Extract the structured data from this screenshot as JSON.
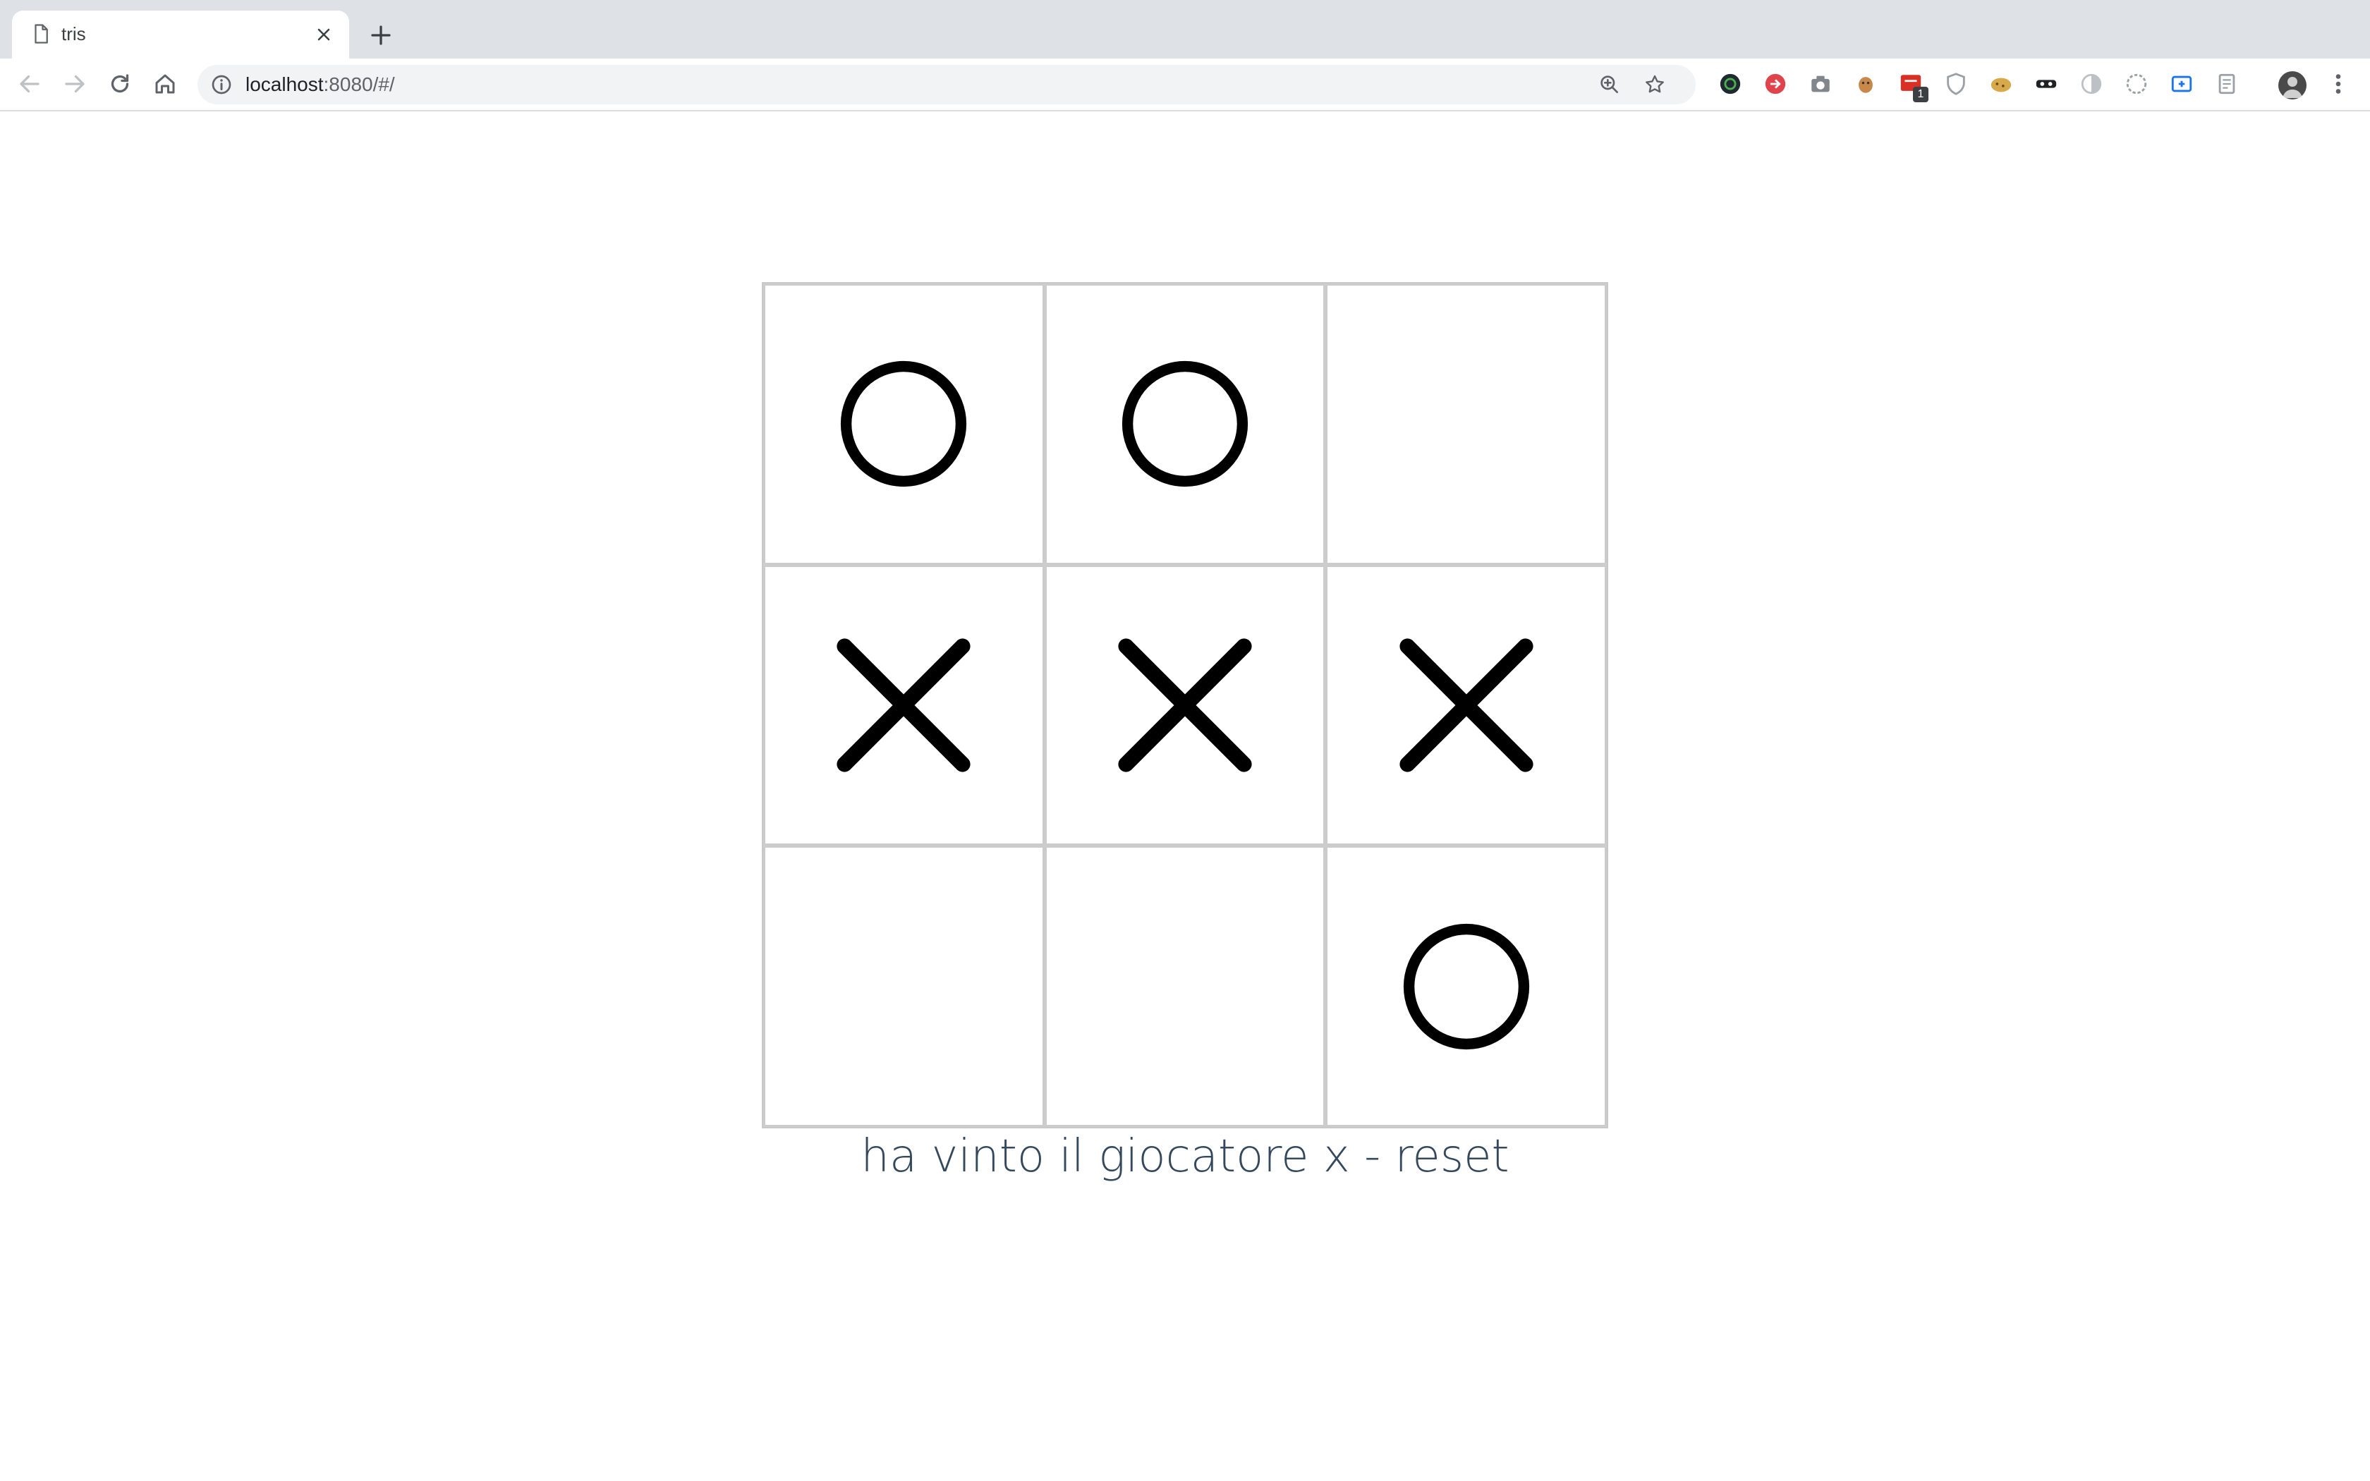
{
  "browser": {
    "tab_title": "tris",
    "new_tab_label": "+",
    "url_host": "localhost",
    "url_path": ":8080/#/",
    "extension_badge": "1",
    "icons": {
      "tab": "document-icon",
      "close": "close-icon",
      "back": "back-arrow-icon",
      "forward": "forward-arrow-icon",
      "reload": "reload-icon",
      "home": "home-icon",
      "info": "info-icon",
      "zoom": "zoom-icon",
      "bookmark": "star-icon",
      "menu": "kebab-menu-icon"
    },
    "extensions": [
      {
        "name": "extension-dark-circle-icon",
        "color": "#1f2a30"
      },
      {
        "name": "extension-red-badge-icon",
        "color": "#e0434b"
      },
      {
        "name": "extension-camera-icon",
        "color": "#80868b"
      },
      {
        "name": "extension-face-icon",
        "color": "#c7884a"
      },
      {
        "name": "extension-red-counter-icon",
        "color": "#d93025"
      },
      {
        "name": "extension-shield-icon",
        "color": "#9aa0a6"
      },
      {
        "name": "extension-cookie-icon",
        "color": "#d8a94b"
      },
      {
        "name": "extension-mask-icon",
        "color": "#202124"
      },
      {
        "name": "extension-half-circle-icon",
        "color": "#bdc1c6"
      },
      {
        "name": "extension-dotted-circle-icon",
        "color": "#9aa0a6"
      },
      {
        "name": "extension-blue-box-icon",
        "color": "#1a73e8"
      },
      {
        "name": "extension-document-icon",
        "color": "#9aa0a6"
      }
    ]
  },
  "game": {
    "board": [
      "O",
      "O",
      "",
      "X",
      "X",
      "X",
      "",
      "",
      "O"
    ],
    "status_text": "ha vinto il giocatore x - ",
    "reset_label": "reset",
    "mark_color": "#000000",
    "grid_color": "#cccccc",
    "text_color": "#34495e"
  }
}
